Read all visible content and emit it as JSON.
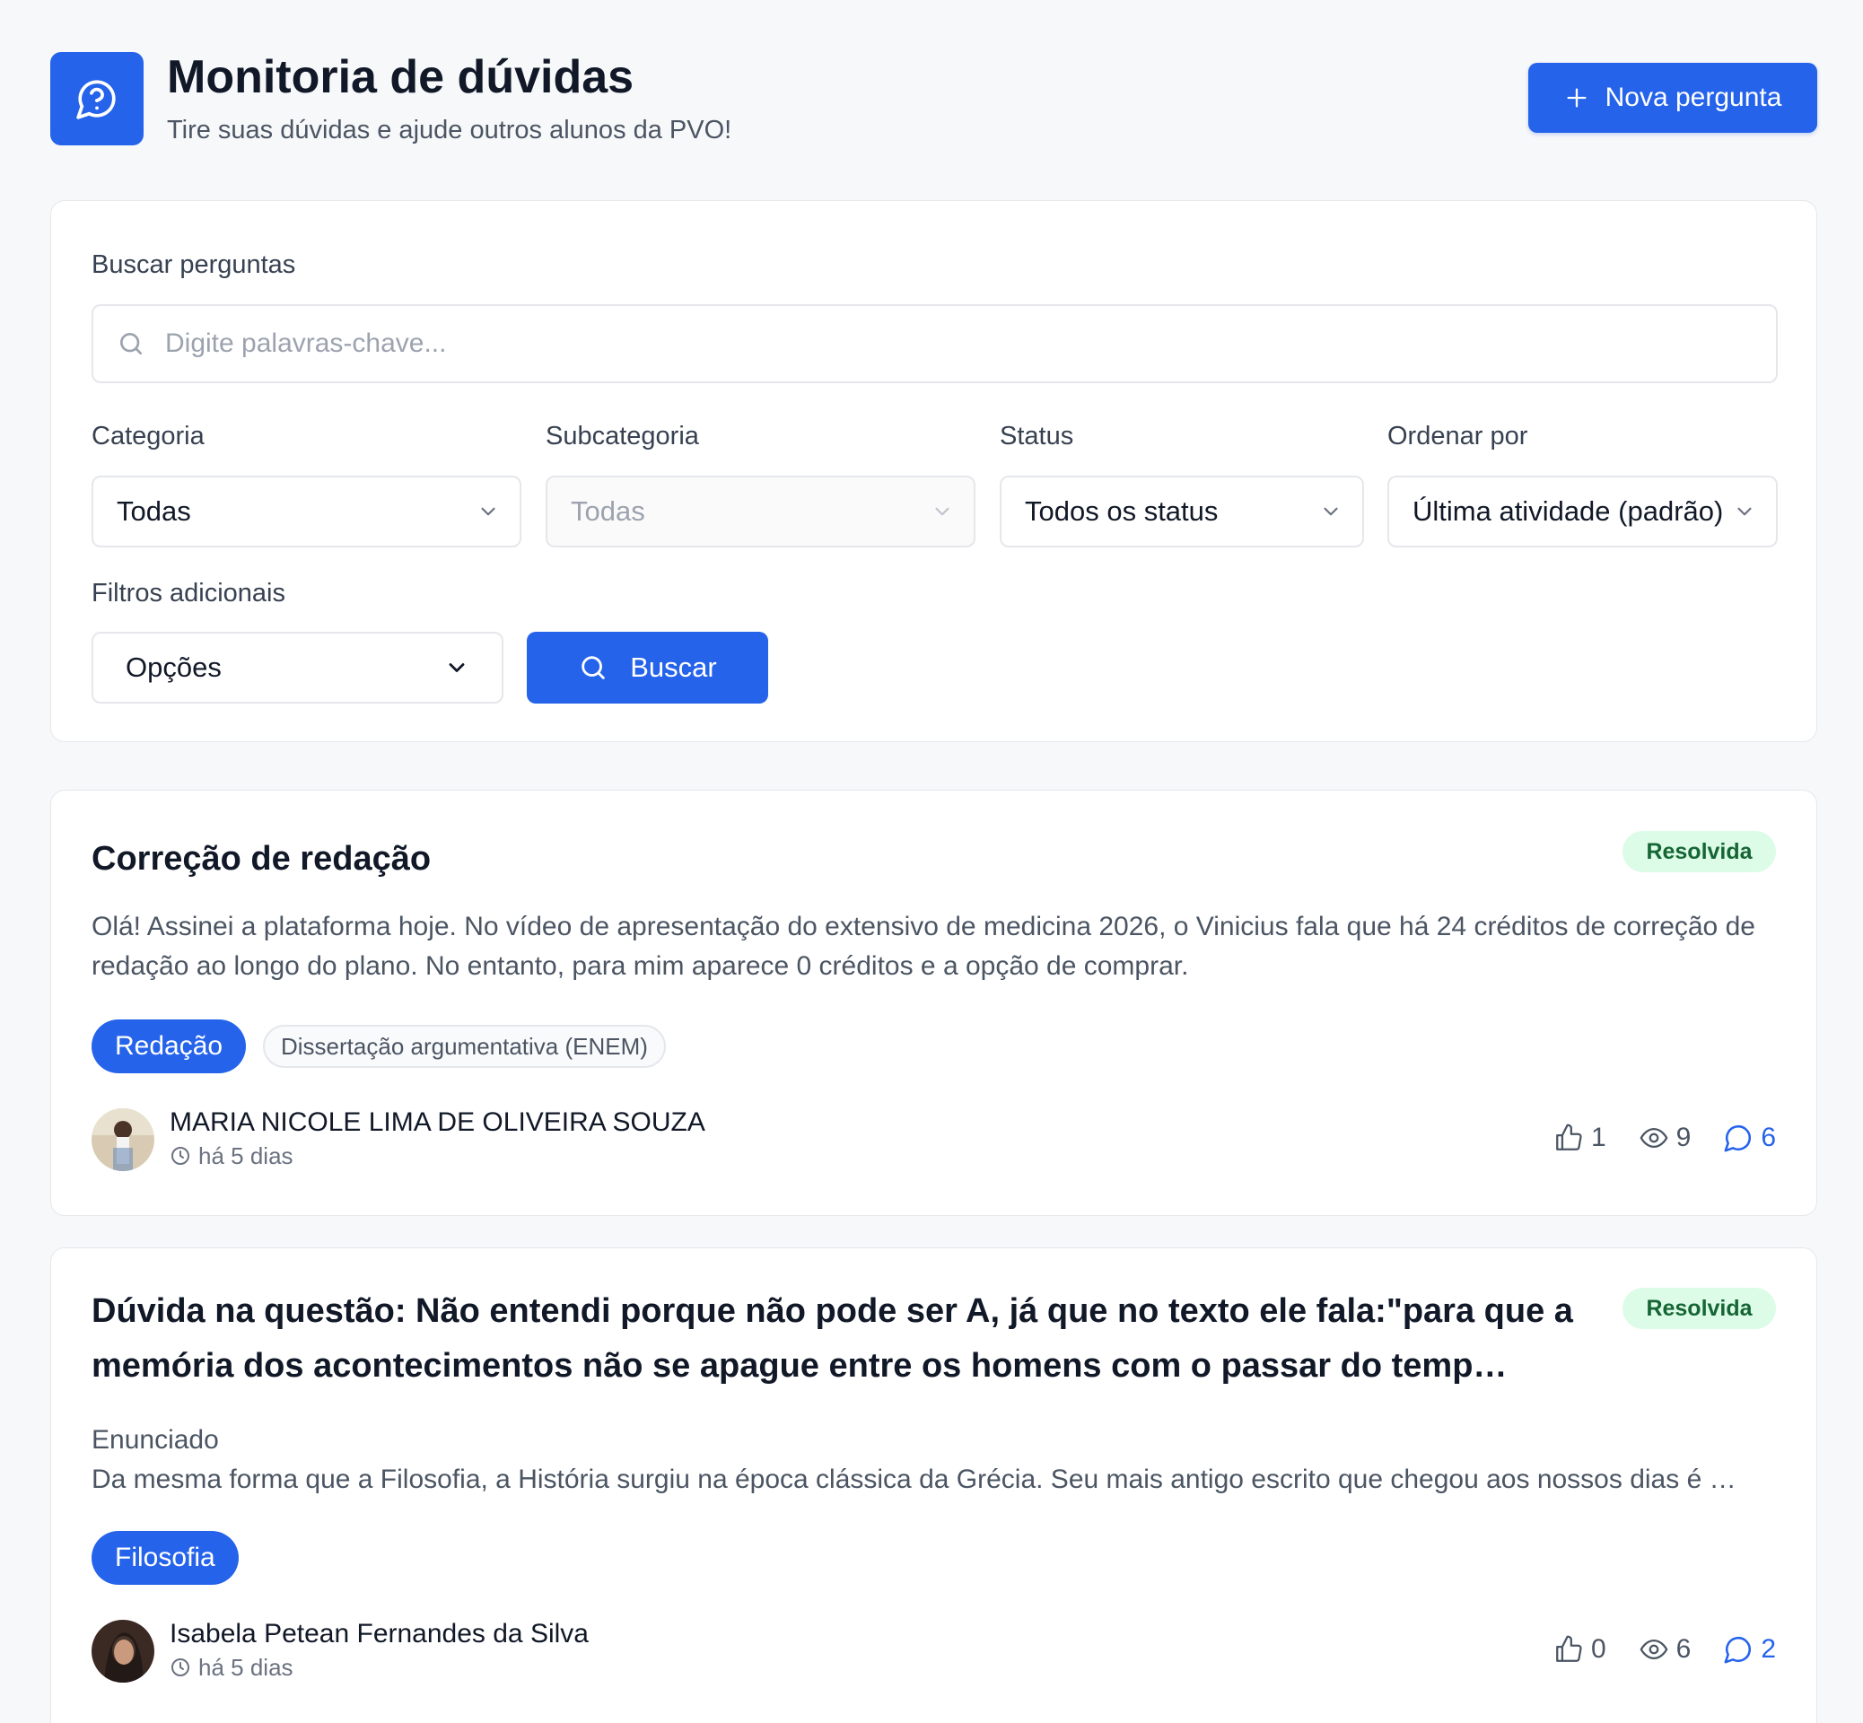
{
  "header": {
    "logo_icon": "question-chat-icon",
    "title": "Monitoria de dúvidas",
    "subtitle": "Tire suas dúvidas e ajude outros alunos da PVO!",
    "new_question_label": "Nova pergunta",
    "accent_color": "#2563eb"
  },
  "filters": {
    "search_label": "Buscar perguntas",
    "search_placeholder": "Digite palavras-chave...",
    "category": {
      "label": "Categoria",
      "value": "Todas"
    },
    "subcategory": {
      "label": "Subcategoria",
      "value": "Todas",
      "disabled": true
    },
    "status": {
      "label": "Status",
      "value": "Todos os status"
    },
    "sort": {
      "label": "Ordenar por",
      "value": "Última atividade (padrão)"
    },
    "extra": {
      "label": "Filtros adicionais",
      "value": "Opções"
    },
    "search_button": "Buscar"
  },
  "questions": [
    {
      "title": "Correção de redação",
      "status": "Resolvida",
      "body": "Olá! Assinei a plataforma hoje. No vídeo de apresentação do extensivo de medicina 2026, o Vinicius fala que há 24 créditos de correção de redação ao longo do plano. No entanto, para mim aparece 0 créditos e a opção de comprar.",
      "category": "Redação",
      "subcategory": "Dissertação argumentativa (ENEM)",
      "author": "MARIA NICOLE LIMA DE OLIVEIRA SOUZA",
      "time": "há 5 dias",
      "likes": "1",
      "views": "9",
      "comments": "6"
    },
    {
      "title": "Dúvida na questão: Não entendi porque não pode ser A, já que no texto ele fala:\"para que a memória dos acontecimentos não se apague entre os homens com o passar do temp…",
      "status": "Resolvida",
      "body_heading": "Enunciado",
      "body": "Da mesma forma que a Filosofia, a História surgiu na época clássica da Grécia. Seu mais antigo escrito que chegou aos nossos dias é …",
      "category": "Filosofia",
      "author": "Isabela Petean Fernandes da Silva",
      "time": "há 5 dias",
      "likes": "0",
      "views": "6",
      "comments": "2"
    }
  ]
}
